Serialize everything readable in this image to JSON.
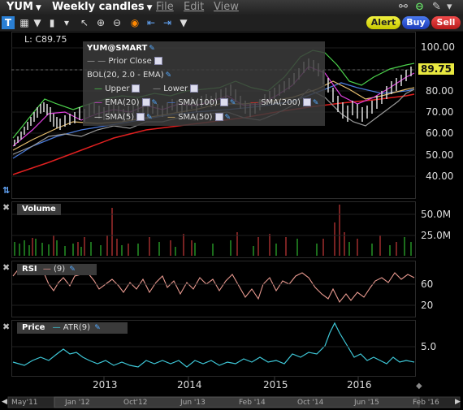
{
  "menubar": {
    "symbol": "YUM",
    "period": "Weekly candles",
    "menus": [
      "File",
      "Edit",
      "View"
    ]
  },
  "actions": {
    "alert": "Alert",
    "buy": "Buy",
    "sell": "Sell"
  },
  "price_pane": {
    "last_label": "L: C89.75",
    "last_price": "89.75",
    "y_ticks": [
      "100.00",
      "90.00",
      "80.00",
      "70.00",
      "60.00",
      "50.00",
      "40.00"
    ],
    "legend": {
      "title": "YUM@SMART",
      "prior_close": "Prior Close",
      "bol": "BOL(20, 2.0 - EMA)",
      "upper": "Upper",
      "lower": "Lower",
      "ema20": "EMA(20)",
      "sma100": "SMA(100)",
      "sma200": "SMA(200)",
      "sma5": "SMA(5)",
      "sma50": "SMA(50)"
    },
    "colors": {
      "upper": "#4cd24c",
      "lower": "#9a9a9a",
      "ema20": "#e040e0",
      "sma100": "#4a7ad8",
      "sma200": "#e02020",
      "sma5": "#e0e0e0",
      "sma50": "#e8c070",
      "last_price_bg": "#e8e840"
    }
  },
  "volume_pane": {
    "title": "Volume",
    "y_ticks": [
      "50.0M",
      "25.0M"
    ]
  },
  "rsi_pane": {
    "title": "RSI",
    "indicator": "(9)",
    "y_ticks": [
      "60",
      "20"
    ]
  },
  "atr_pane": {
    "title": "Price",
    "indicator": "ATR(9)",
    "y_ticks": [
      "5.0"
    ]
  },
  "x_axis": {
    "years": [
      "2013",
      "2014",
      "2015",
      "2016"
    ]
  },
  "timeline": {
    "ticks": [
      "May'11",
      "Jan '12",
      "Oct'12",
      "Jun '13",
      "Feb '14",
      "Oct '14",
      "Jun '15",
      "Feb '16"
    ]
  }
}
